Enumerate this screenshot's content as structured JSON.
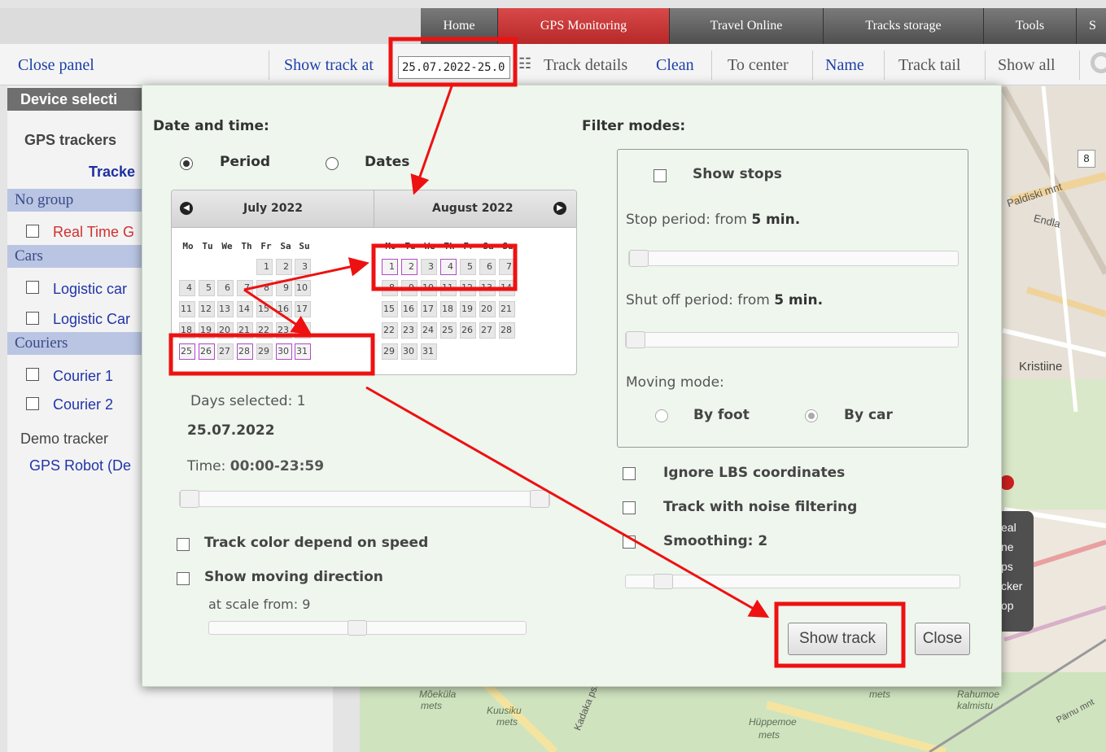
{
  "nav": {
    "tabs": [
      {
        "label": "Home"
      },
      {
        "label": "GPS Monitoring",
        "active": true
      },
      {
        "label": "Travel Online"
      },
      {
        "label": "Tracks storage"
      },
      {
        "label": "Tools"
      },
      {
        "label": "S"
      }
    ]
  },
  "toolbar": {
    "close_panel": "Close panel",
    "show_track_at": "Show track at",
    "date_value": "25.07.2022-25.0",
    "track_details": "Track details",
    "clean": "Clean",
    "to_center": "To center",
    "name": "Name",
    "track_tail": "Track tail",
    "show_all": "Show all"
  },
  "left_panel": {
    "header": "Device selecti",
    "gps_trackers": "GPS trackers",
    "trackers_link": "Tracke",
    "groups": {
      "no_group": "No group",
      "cars": "Cars",
      "couriers": "Couriers"
    },
    "items": {
      "real_time": "Real Time G",
      "logistic_car_1": "Logistic car",
      "logistic_car_2": "Logistic Car",
      "courier_1": "Courier 1",
      "courier_2": "Courier 2"
    },
    "demo_tracker": "Demo tracker",
    "gps_robot": "GPS Robot (De"
  },
  "map": {
    "badge": "8",
    "labels": {
      "paldiski": "Paldiski mnt",
      "endla": "Endla",
      "kristiine": "Kristiine",
      "mets": "mets",
      "moekula": "Mõeküla",
      "kuusiku": "Kuusiku",
      "huppemoe": "Hüppemoe",
      "rahumoe": "Rahumoe",
      "kalmistu": "kalmistu",
      "kadaka": "Kadaka pst",
      "parnu": "Pärnu mnt"
    },
    "side_tip": [
      "eal",
      "ne",
      "ps",
      "cker",
      "op"
    ]
  },
  "dialog": {
    "date_time_title": "Date and time:",
    "period_label": "Period",
    "dates_label": "Dates",
    "calendar": {
      "month1": "July 2022",
      "month2": "August 2022",
      "weekdays": [
        "Mo",
        "Tu",
        "We",
        "Th",
        "Fr",
        "Sa",
        "Su"
      ]
    },
    "days_selected": "Days selected: 1",
    "selected_date": "25.07.2022",
    "time_label": "Time: ",
    "time_value": "00:00-23:59",
    "track_color_speed": "Track color depend on speed",
    "show_moving_direction": "Show moving direction",
    "at_scale_label": "at scale from: 9",
    "filter_modes_title": "Filter modes:",
    "show_stops": "Show stops",
    "stop_period_label": "Stop period: from ",
    "stop_period_value": "5 min.",
    "shutoff_label": "Shut off period: from ",
    "shutoff_value": "5 min.",
    "moving_mode_label": "Moving mode:",
    "by_foot": "By foot",
    "by_car": "By car",
    "ignore_lbs": "Ignore LBS coordinates",
    "noise_filtering": "Track with noise filtering",
    "smoothing": "Smoothing: 2",
    "show_track_button": "Show track",
    "close_button": "Close"
  },
  "colors": {
    "annotation_red": "#ee1111",
    "selected_day_border": "#b14ac7",
    "active_tab": "#c23232",
    "link_blue": "#1d3fa8"
  }
}
